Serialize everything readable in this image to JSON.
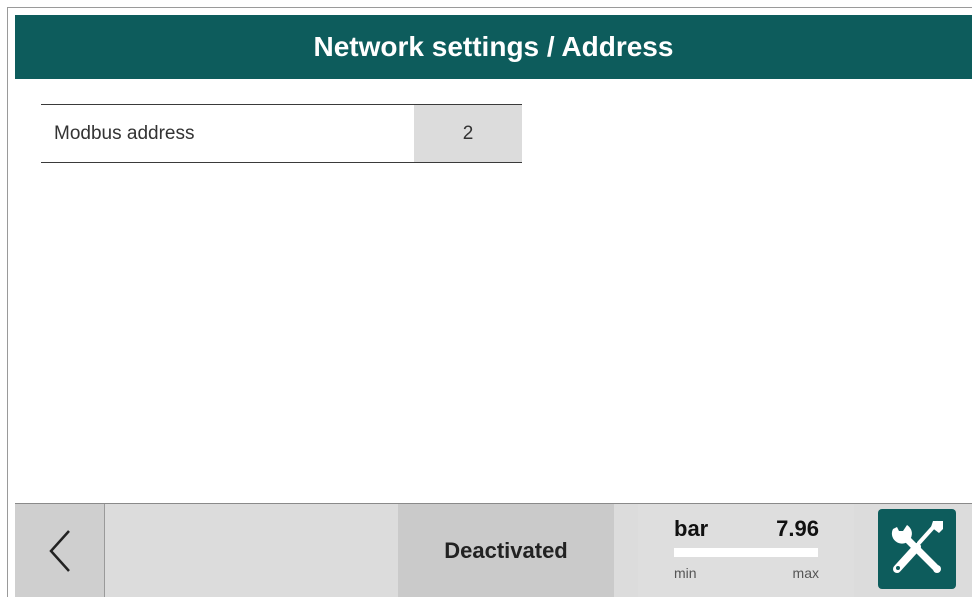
{
  "header": {
    "title": "Network settings / Address"
  },
  "settings": {
    "rows": [
      {
        "label": "Modbus address",
        "value": "2"
      }
    ]
  },
  "footer": {
    "back_icon": "chevron-left-icon",
    "status": "Deactivated",
    "gauge": {
      "unit": "bar",
      "value": "7.96",
      "min_label": "min",
      "max_label": "max",
      "fill_fraction": 1.0
    },
    "tools_icon": "wrench-screwdriver-icon"
  },
  "colors": {
    "accent": "#0d5c5c",
    "footer_bg": "#dcdcdc",
    "value_cell_bg": "#dcdcdc"
  }
}
